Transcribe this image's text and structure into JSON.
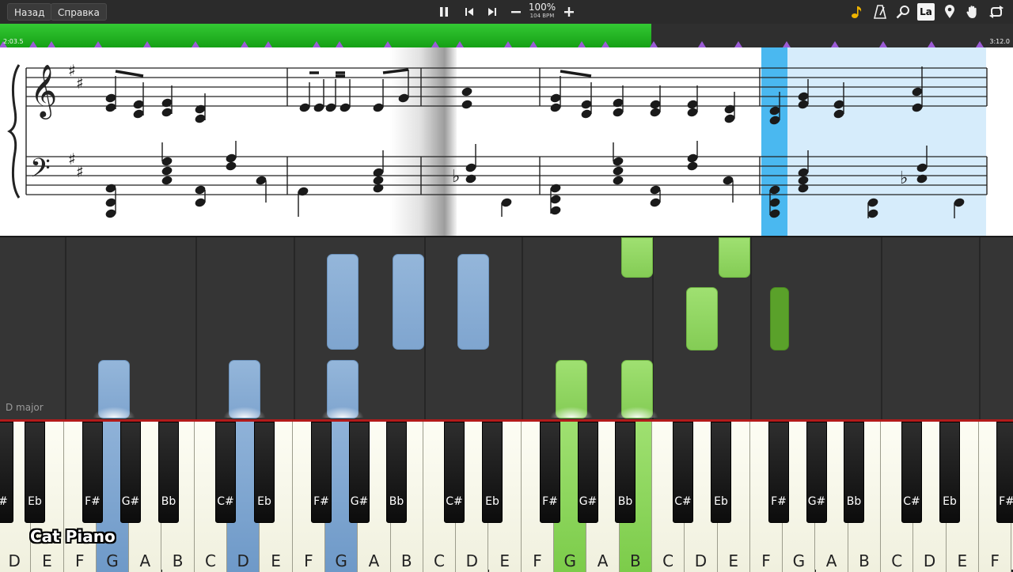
{
  "toolbar": {
    "back_label": "Назад",
    "help_label": "Справка",
    "zoom": "100%",
    "tempo": "104 BPM",
    "language_badge": "La",
    "icons": [
      "pause-icon",
      "previous-icon",
      "next-icon",
      "zoom-out-icon",
      "zoom-in-icon",
      "note-icon",
      "metronome-icon",
      "search-icon",
      "language-icon",
      "marker-icon",
      "hand-icon",
      "loop-icon"
    ],
    "accent_color": "#f0b400"
  },
  "timeline": {
    "start_time": "2:03.5",
    "end_time": "3:12.0",
    "progress": 0.643,
    "progress_color": "#22b422"
  },
  "sheet": {
    "key_signature": "D major",
    "highlight_color": "#d6ecfb",
    "cursor_color": "#4ab8f0"
  },
  "piano_roll": {
    "left_hand_color": "#8fb2d8",
    "right_hand_color": "#93d86a"
  },
  "keyboard": {
    "white_keys": [
      "D",
      "E",
      "F",
      "G",
      "A",
      "B",
      "C",
      "D",
      "E",
      "F",
      "G",
      "A",
      "B",
      "C",
      "D",
      "E",
      "F",
      "G",
      "A",
      "B",
      "C",
      "D",
      "E",
      "F",
      "G",
      "A",
      "B",
      "C",
      "D",
      "E",
      "F"
    ],
    "black_keys": [
      "#",
      "Eb",
      "F#",
      "G#",
      "Bb",
      "C#",
      "Eb",
      "F#",
      "G#",
      "Bb",
      "C#",
      "Eb",
      "F#",
      "G#",
      "Bb",
      "C#",
      "Eb",
      "F#",
      "G#",
      "Bb",
      "C#",
      "Eb",
      "F#"
    ],
    "pressed_left": [
      "G",
      "D",
      "G"
    ],
    "pressed_right": [
      "G",
      "B"
    ]
  },
  "brand": {
    "logo_text": "Cat Piano"
  }
}
